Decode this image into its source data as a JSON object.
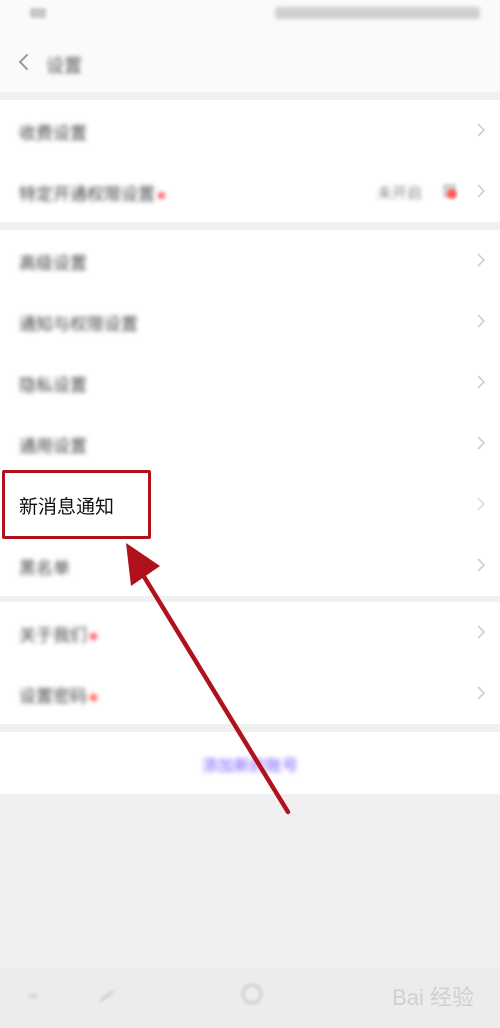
{
  "header": {
    "title": "设置"
  },
  "section1": [
    {
      "label": "收费设置"
    },
    {
      "label": "特定开通权限设置",
      "value": "未开启"
    }
  ],
  "section2": [
    {
      "label": "高级设置"
    },
    {
      "label": "通知与权限设置"
    },
    {
      "label": "隐私设置"
    },
    {
      "label": "通用设置"
    },
    {
      "label": "新消息通知"
    },
    {
      "label": "黑名单"
    }
  ],
  "section3": [
    {
      "label": "关于我们"
    },
    {
      "label": "设置密码"
    }
  ],
  "link": {
    "label": "添加新的账号"
  },
  "watermark": "Bai 经验",
  "colors": {
    "highlight": "#b0121b",
    "link": "#7a5cff",
    "dot": "#ff4d4f"
  }
}
